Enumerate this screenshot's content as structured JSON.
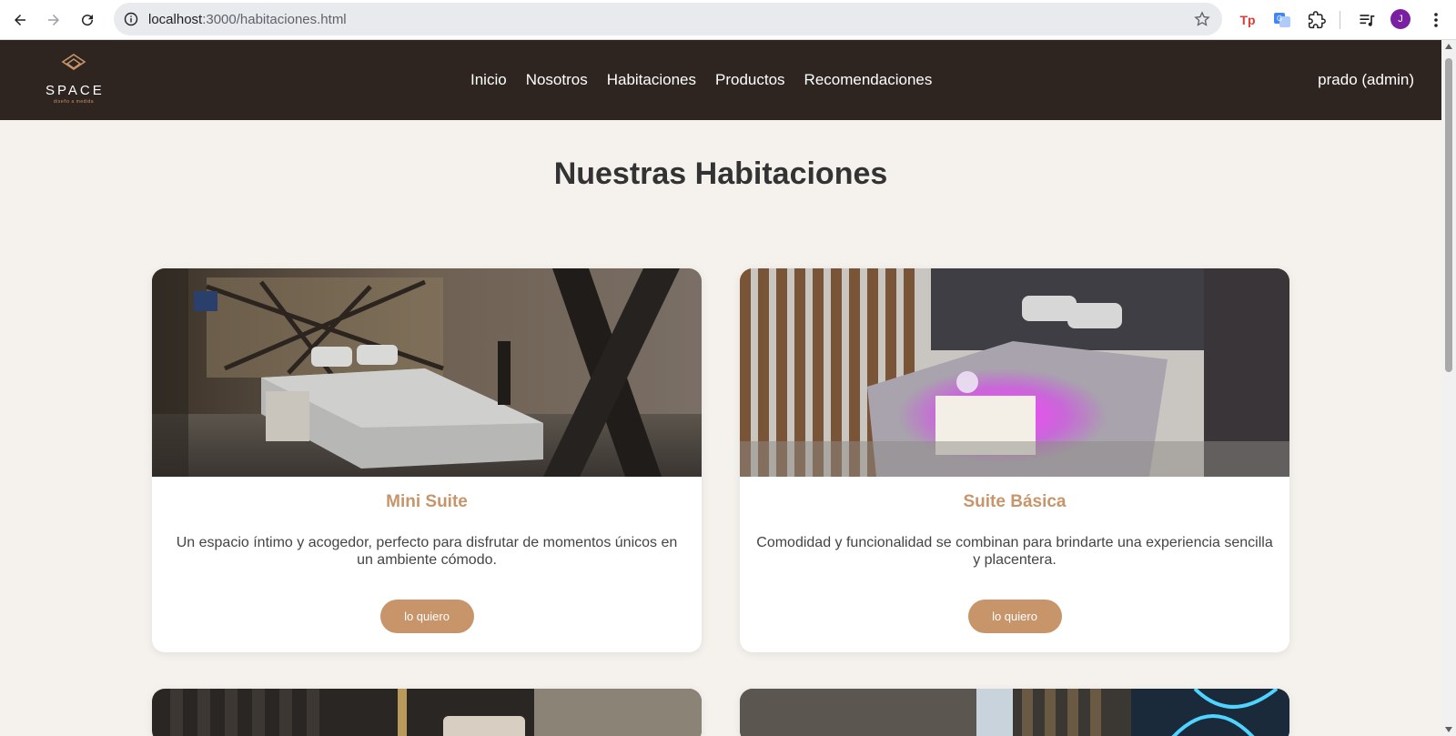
{
  "browser": {
    "url_host": "localhost",
    "url_path": ":3000/habitaciones.html",
    "avatar_letter": "J",
    "extension_tp": "Tp"
  },
  "header": {
    "logo_text": "SPACE",
    "logo_sub": "diseño a medida",
    "nav": [
      "Inicio",
      "Nosotros",
      "Habitaciones",
      "Productos",
      "Recomendaciones"
    ],
    "user": "prado (admin)"
  },
  "main": {
    "title": "Nuestras Habitaciones",
    "cards": [
      {
        "title": "Mini Suite",
        "description": "Un espacio íntimo y acogedor, perfecto para disfrutar de momentos únicos en un ambiente cómodo.",
        "button": "lo quiero"
      },
      {
        "title": "Suite Básica",
        "description": "Comodidad y funcionalidad se combinan para brindarte una experiencia sencilla y placentera.",
        "button": "lo quiero"
      }
    ]
  },
  "colors": {
    "header_bg": "#2e2420",
    "accent": "#c8956a",
    "page_bg": "#f5f2ee"
  }
}
